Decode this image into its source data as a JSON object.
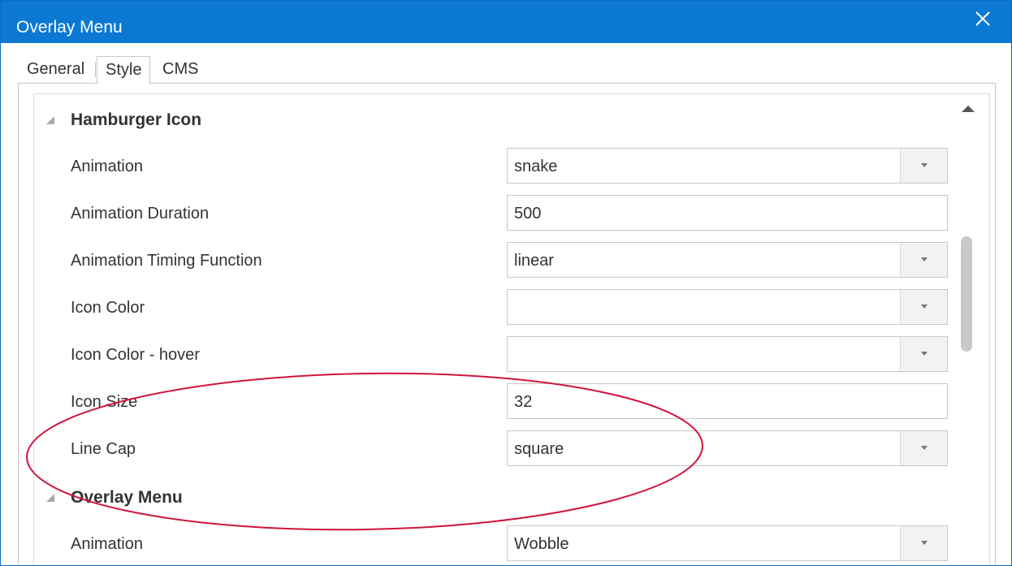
{
  "window": {
    "title": "Overlay Menu",
    "close_icon": "close-icon"
  },
  "tabs": [
    {
      "label": "General",
      "active": false
    },
    {
      "label": "Style",
      "active": true
    },
    {
      "label": "CMS",
      "active": false
    }
  ],
  "sections": [
    {
      "title": "Hamburger Icon",
      "expanded": true,
      "rows": [
        {
          "label": "Animation",
          "value": "snake",
          "type": "dropdown"
        },
        {
          "label": "Animation Duration",
          "value": "500",
          "type": "text"
        },
        {
          "label": "Animation Timing Function",
          "value": "linear",
          "type": "dropdown"
        },
        {
          "label": "Icon Color",
          "value": "",
          "type": "dropdown"
        },
        {
          "label": "Icon Color - hover",
          "value": "",
          "type": "dropdown"
        },
        {
          "label": "Icon Size",
          "value": "32",
          "type": "text"
        },
        {
          "label": "Line Cap",
          "value": "square",
          "type": "dropdown"
        }
      ]
    },
    {
      "title": "Overlay Menu",
      "expanded": true,
      "rows": [
        {
          "label": "Animation",
          "value": "Wobble",
          "type": "dropdown"
        }
      ]
    }
  ],
  "colors": {
    "titlebar": "#0b78d4",
    "annotation": "#d0143c"
  },
  "icons": {
    "section_toggle": "expanded-triangle-icon",
    "dropdown": "dropdown-arrow-icon",
    "scroll_up": "scroll-up-arrow-icon"
  }
}
